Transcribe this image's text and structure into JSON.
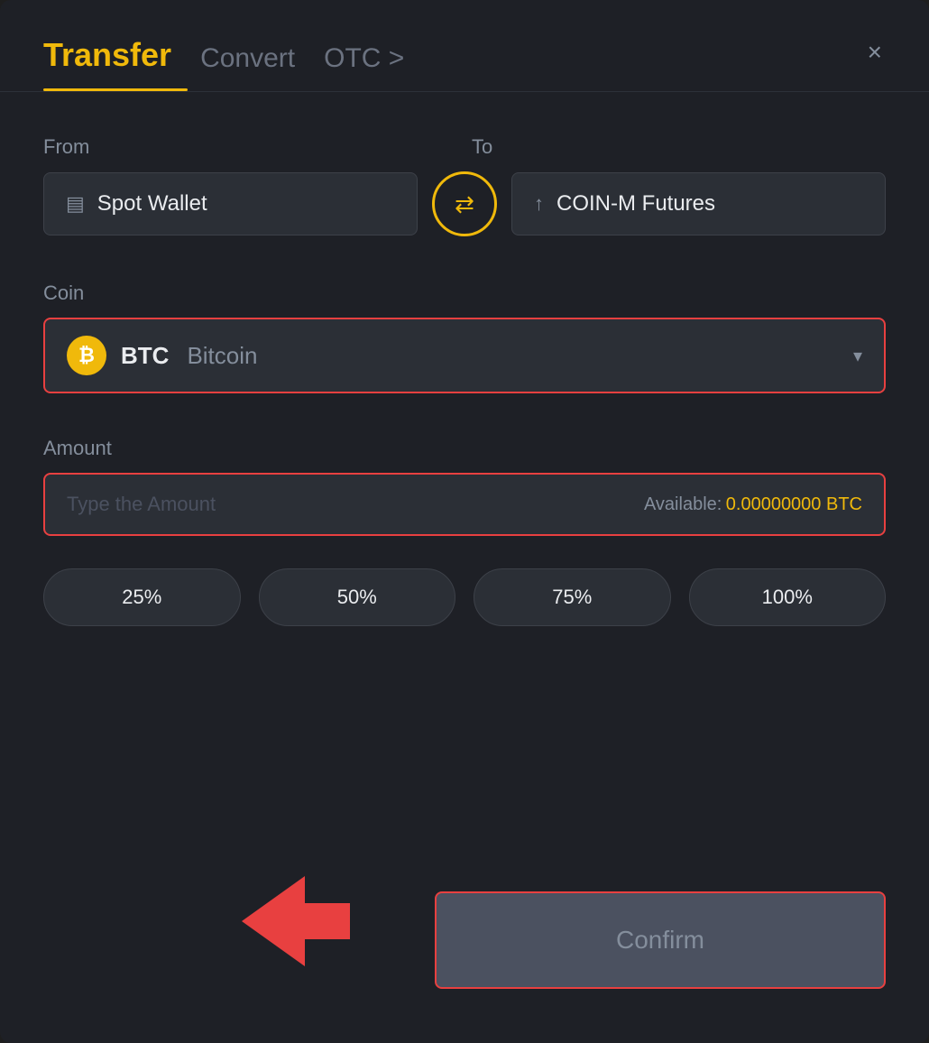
{
  "header": {
    "title": "Transfer",
    "tabs": [
      {
        "id": "transfer",
        "label": "Transfer",
        "active": true
      },
      {
        "id": "convert",
        "label": "Convert",
        "active": false
      },
      {
        "id": "otc",
        "label": "OTC >",
        "active": false
      }
    ],
    "close_label": "×"
  },
  "from": {
    "label": "From",
    "wallet": "Spot Wallet"
  },
  "to": {
    "label": "To",
    "wallet": "COIN-M Futures"
  },
  "coin": {
    "label": "Coin",
    "symbol": "BTC",
    "name": "Bitcoin"
  },
  "amount": {
    "label": "Amount",
    "placeholder": "Type the Amount",
    "available_label": "Available:",
    "available_value": "0.00000000 BTC"
  },
  "percent_buttons": [
    {
      "label": "25%"
    },
    {
      "label": "50%"
    },
    {
      "label": "75%"
    },
    {
      "label": "100%"
    }
  ],
  "confirm_button": {
    "label": "Confirm"
  },
  "icons": {
    "close": "×",
    "swap": "⇌",
    "card": "▤",
    "futures_arrow": "↑",
    "btc": "₿",
    "chevron_down": "▾"
  }
}
